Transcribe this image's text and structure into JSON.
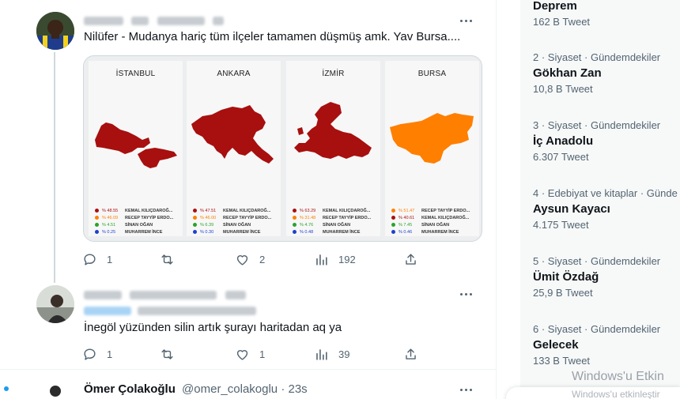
{
  "tweet1": {
    "text": "Nilüfer - Mudanya hariç tüm ilçeler tamamen düşmüş amk. Yav Bursa....",
    "reply_count": "1",
    "like_count": "2",
    "view_count": "192"
  },
  "maps": [
    {
      "title": "İSTANBUL",
      "color": "#a80f0f",
      "results": [
        {
          "pct": "% 48.55",
          "name": "KEMAL KILIÇDAROĞ...",
          "color": "#a80f0f"
        },
        {
          "pct": "% 46.09",
          "name": "RECEP TAYYİP ERDO...",
          "color": "#ff7f00"
        },
        {
          "pct": "% 4.51",
          "name": "SİNAN OĞAN",
          "color": "#2aa32a"
        },
        {
          "pct": "% 0.25",
          "name": "MUHARREM İNCE",
          "color": "#1f3fcf"
        }
      ]
    },
    {
      "title": "ANKARA",
      "color": "#a80f0f",
      "results": [
        {
          "pct": "% 47.51",
          "name": "KEMAL KILIÇDAROĞ...",
          "color": "#a80f0f"
        },
        {
          "pct": "% 46.00",
          "name": "RECEP TAYYİP ERDO...",
          "color": "#ff7f00"
        },
        {
          "pct": "% 6.39",
          "name": "SİNAN OĞAN",
          "color": "#2aa32a"
        },
        {
          "pct": "% 0.30",
          "name": "MUHARREM İNCE",
          "color": "#1f3fcf"
        }
      ]
    },
    {
      "title": "İZMİR",
      "color": "#a80f0f",
      "results": [
        {
          "pct": "% 63.29",
          "name": "KEMAL KILIÇDAROĞ...",
          "color": "#a80f0f"
        },
        {
          "pct": "% 31.48",
          "name": "RECEP TAYYİP ERDO...",
          "color": "#ff7f00"
        },
        {
          "pct": "% 4.76",
          "name": "SİNAN OĞAN",
          "color": "#2aa32a"
        },
        {
          "pct": "% 0.48",
          "name": "MUHARREM İNCE",
          "color": "#1f3fcf"
        }
      ]
    },
    {
      "title": "BURSA",
      "color": "#ff7f00",
      "results": [
        {
          "pct": "% 51.47",
          "name": "RECEP TAYYİP ERDO...",
          "color": "#ff7f00"
        },
        {
          "pct": "% 40.61",
          "name": "KEMAL KILIÇDAROĞ...",
          "color": "#a80f0f"
        },
        {
          "pct": "% 7.45",
          "name": "SİNAN OĞAN",
          "color": "#2aa32a"
        },
        {
          "pct": "% 0.46",
          "name": "MUHARREM İNCE",
          "color": "#1f3fcf"
        }
      ]
    }
  ],
  "tweet2": {
    "text": "İnegöl yüzünden silin artık şurayı haritadan aq ya",
    "reply_count": "1",
    "like_count": "1",
    "view_count": "39"
  },
  "tweet3": {
    "author_name": "Ömer Çolakoğlu",
    "handle_time": "@omer_colakoglu · 23s"
  },
  "trends": [
    {
      "meta": "",
      "name": "Deprem",
      "count": "162 B Tweet"
    },
    {
      "meta": "2 · Siyaset · Gündemdekiler",
      "name": "Gökhan Zan",
      "count": "10,8 B Tweet"
    },
    {
      "meta": "3 · Siyaset · Gündemdekiler",
      "name": "İç Anadolu",
      "count": "6.307 Tweet"
    },
    {
      "meta": "4 · Edebiyat ve kitaplar · Günde",
      "name": "Aysun Kayacı",
      "count": "4.175 Tweet"
    },
    {
      "meta": "5 · Siyaset · Gündemdekiler",
      "name": "Ümit Özdağ",
      "count": "25,9 B Tweet"
    },
    {
      "meta": "6 · Siyaset · Gündemdekiler",
      "name": "Gelecek",
      "count": "133 B Tweet"
    }
  ],
  "watermark": {
    "line1": "Windows'u Etkin",
    "line2": "Windows'u etkinleştir"
  },
  "icons": {
    "reply": "reply-icon",
    "retweet": "retweet-icon",
    "like": "heart-icon",
    "views": "views-icon",
    "share": "share-icon",
    "more": "more-icon"
  }
}
